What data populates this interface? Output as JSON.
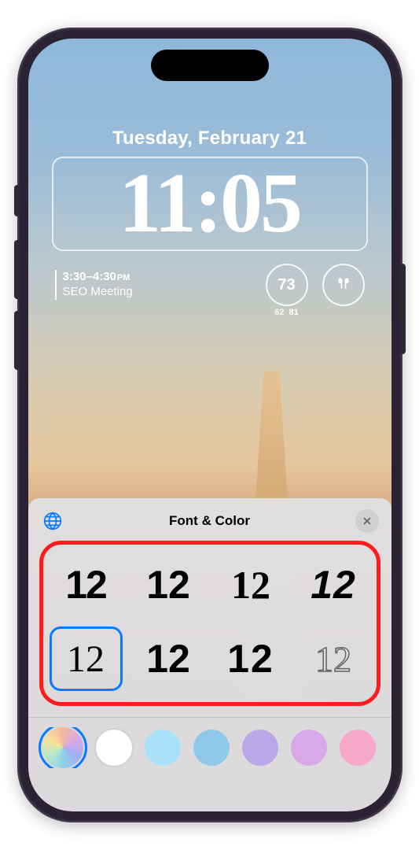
{
  "lockscreen": {
    "date": "Tuesday, February 21",
    "time": "11:05",
    "calendar": {
      "time_range": "3:30–4:30",
      "ampm": "PM",
      "title": "SEO Meeting"
    },
    "weather": {
      "temp": "73",
      "low": "62",
      "high": "81"
    }
  },
  "sheet": {
    "title": "Font & Color",
    "font_sample": "12",
    "fonts": [
      {
        "id": "sf-bold"
      },
      {
        "id": "sf-rounded"
      },
      {
        "id": "ny-bold"
      },
      {
        "id": "stencil"
      },
      {
        "id": "ny-serif",
        "selected": true
      },
      {
        "id": "black"
      },
      {
        "id": "spaced"
      },
      {
        "id": "outline"
      }
    ],
    "colors": [
      {
        "id": "rainbow",
        "selected": true
      },
      {
        "id": "white"
      },
      {
        "id": "light-blue"
      },
      {
        "id": "medium-blue"
      },
      {
        "id": "lavender"
      },
      {
        "id": "purple"
      },
      {
        "id": "pink"
      }
    ]
  }
}
